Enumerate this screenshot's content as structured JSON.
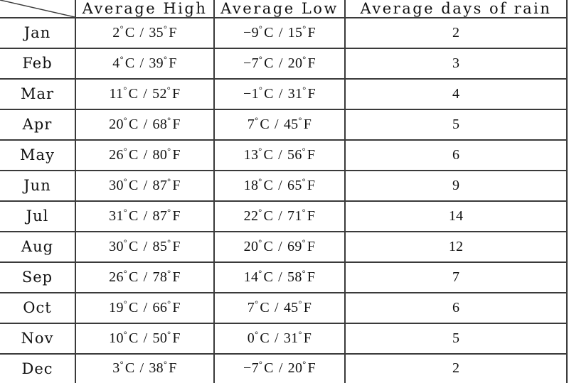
{
  "table": {
    "corner_icon": "diagonal-divider-icon",
    "columns": [
      {
        "key": "month",
        "label": ""
      },
      {
        "key": "high",
        "label": "Average High"
      },
      {
        "key": "low",
        "label": "Average Low"
      },
      {
        "key": "rain",
        "label": "Average days of rain"
      }
    ],
    "rows": [
      {
        "month": "Jan",
        "high_c": "2",
        "high_f": "35",
        "low_c": "−9",
        "low_f": "15",
        "rain": "2"
      },
      {
        "month": "Feb",
        "high_c": "4",
        "high_f": "39",
        "low_c": "−7",
        "low_f": "20",
        "rain": "3"
      },
      {
        "month": "Mar",
        "high_c": "11",
        "high_f": "52",
        "low_c": "−1",
        "low_f": "31",
        "rain": "4"
      },
      {
        "month": "Apr",
        "high_c": "20",
        "high_f": "68",
        "low_c": "7",
        "low_f": "45",
        "rain": "5"
      },
      {
        "month": "May",
        "high_c": "26",
        "high_f": "80",
        "low_c": "13",
        "low_f": "56",
        "rain": "6"
      },
      {
        "month": "Jun",
        "high_c": "30",
        "high_f": "87",
        "low_c": "18",
        "low_f": "65",
        "rain": "9"
      },
      {
        "month": "Jul",
        "high_c": "31",
        "high_f": "87",
        "low_c": "22",
        "low_f": "71",
        "rain": "14"
      },
      {
        "month": "Aug",
        "high_c": "30",
        "high_f": "85",
        "low_c": "20",
        "low_f": "69",
        "rain": "12"
      },
      {
        "month": "Sep",
        "high_c": "26",
        "high_f": "78",
        "low_c": "14",
        "low_f": "58",
        "rain": "7"
      },
      {
        "month": "Oct",
        "high_c": "19",
        "high_f": "66",
        "low_c": "7",
        "low_f": "45",
        "rain": "6"
      },
      {
        "month": "Nov",
        "high_c": "10",
        "high_f": "50",
        "low_c": "0",
        "low_f": "31",
        "rain": "5"
      },
      {
        "month": "Dec",
        "high_c": "3",
        "high_f": "38",
        "low_c": "−7",
        "low_f": "20",
        "rain": "2"
      }
    ],
    "units": {
      "degree": "°",
      "celsius": "C",
      "fahrenheit": "F",
      "separator": "/"
    },
    "colors": {
      "border": "#3a3a3a",
      "text": "#111111",
      "background": "#ffffff"
    }
  }
}
